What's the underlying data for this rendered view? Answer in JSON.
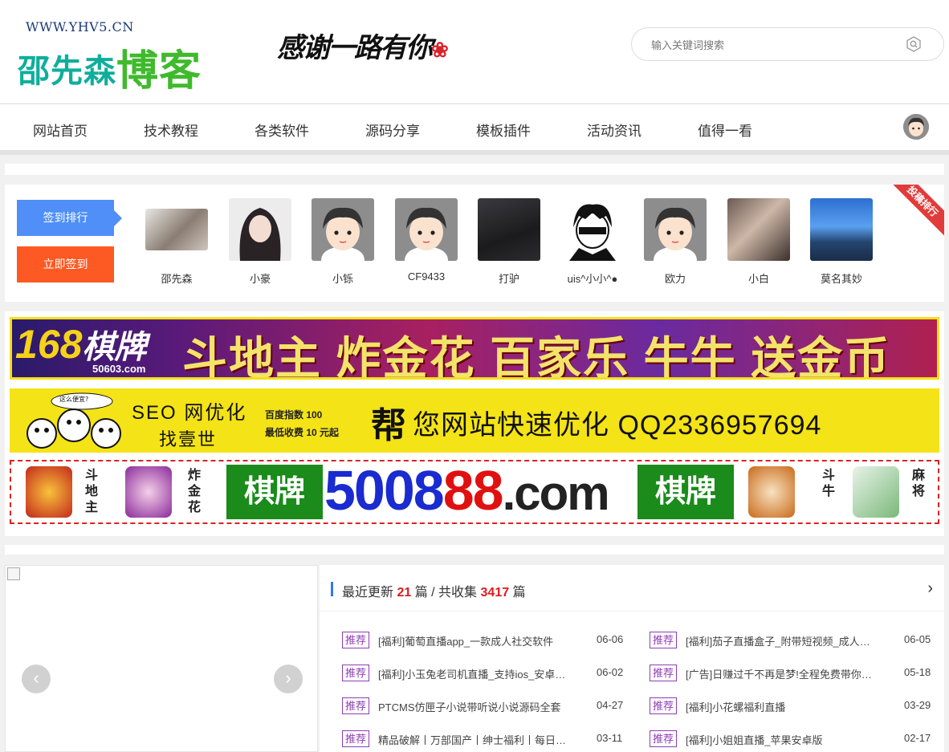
{
  "header": {
    "logo_url": "WWW.YHV5.CN",
    "logo_name_a": "邵先森",
    "logo_name_b": "博客",
    "slogan": "感谢一路有你",
    "search_placeholder": "输入关键词搜索"
  },
  "nav": {
    "items": [
      "网站首页",
      "技术教程",
      "各类软件",
      "源码分享",
      "模板插件",
      "活动资讯",
      "值得一看"
    ]
  },
  "rank": {
    "rank_button": "签到排行",
    "sign_button": "立即签到",
    "ribbon": "投稿排行",
    "users": [
      "邵先森",
      "小豪",
      "小铄",
      "CF9433",
      "打驴",
      "uis^小小^●",
      "欧力",
      "小白",
      "莫名其妙"
    ]
  },
  "ads": {
    "ad1": {
      "brand_num": "168",
      "brand_text": "棋牌",
      "site": "50603.com",
      "slogan": "斗地主 炸金花 百家乐 牛牛 送金币"
    },
    "ad2": {
      "bubble": "这么便宜?",
      "seo": "SEO 网优化",
      "finder": "找壹世",
      "line1": "百度指数 100",
      "line2": "最低收费 10 元起",
      "bang": "帮",
      "rest": "您网站快速优化 QQ2336957694"
    },
    "ad3": {
      "label_left": "斗地主",
      "label_mid": "炸金花",
      "qipai": "棋牌",
      "num_blue": "5008",
      "num_red": "88",
      "num_dark": ".com",
      "label_r1": "斗牛",
      "label_r2": "麻将"
    }
  },
  "slider": {
    "prev": "‹",
    "next": "›"
  },
  "recent": {
    "label_a": "最近更新",
    "count_new": "21",
    "label_b": "篇 / 共收集",
    "count_total": "3417",
    "label_c": "篇",
    "more": "›",
    "posts": [
      {
        "tag": "推荐",
        "title": "[福利]葡萄直播app_一款成人社交软件",
        "date": "06-06"
      },
      {
        "tag": "推荐",
        "title": "[福利]茄子直播盒子_附带短视频_成人直播",
        "date": "06-05"
      },
      {
        "tag": "推荐",
        "title": "[福利]小玉兔老司机直播_支持ios_安卓双端",
        "date": "06-02"
      },
      {
        "tag": "推荐",
        "title": "[广告]日赚过千不再是梦!全程免费带你赚钱",
        "date": "05-18"
      },
      {
        "tag": "推荐",
        "title": "PTCMS仿匣子小说带听说小说源码全套",
        "date": "04-27"
      },
      {
        "tag": "推荐",
        "title": "[福利]小花螺福利直播",
        "date": "03-29"
      },
      {
        "tag": "推荐",
        "title": "精品破解丨万部国产丨绅士福利丨每日更新",
        "date": "03-11"
      },
      {
        "tag": "推荐",
        "title": "[福利]小姐姐直播_苹果安卓版",
        "date": "02-17"
      }
    ]
  },
  "colors": {
    "accent": "#4f8ff7",
    "sign": "#fd5a23",
    "tag": "#8e3db4",
    "count": "#e0191e"
  }
}
